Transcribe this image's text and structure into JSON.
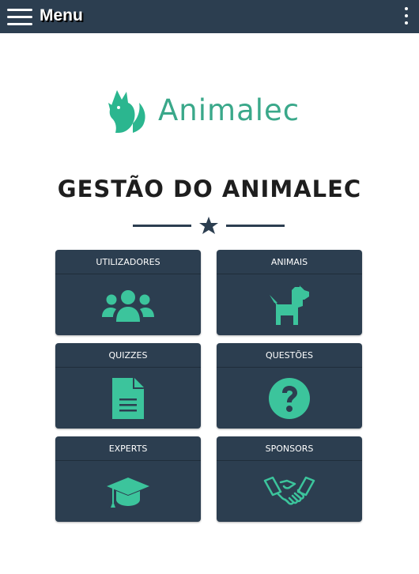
{
  "header": {
    "title": "Menu",
    "menu_icon": "hamburger-icon",
    "more_icon": "kebab-icon",
    "background": "#2c3e50"
  },
  "logo": {
    "text": "Animalec",
    "icon": "fox-icon",
    "color": "#3aa88a"
  },
  "page": {
    "title": "GESTÃO DO ANIMALEC"
  },
  "colors": {
    "card": "#2c3e50",
    "accent": "#3cc49c"
  },
  "cards": [
    {
      "label": "UTILIZADORES",
      "icon": "users-icon"
    },
    {
      "label": "ANIMAIS",
      "icon": "dog-icon"
    },
    {
      "label": "QUIZZES",
      "icon": "document-icon"
    },
    {
      "label": "QUESTÕES",
      "icon": "question-circle-icon"
    },
    {
      "label": "EXPERTS",
      "icon": "graduation-cap-icon"
    },
    {
      "label": "SPONSORS",
      "icon": "handshake-icon"
    }
  ]
}
